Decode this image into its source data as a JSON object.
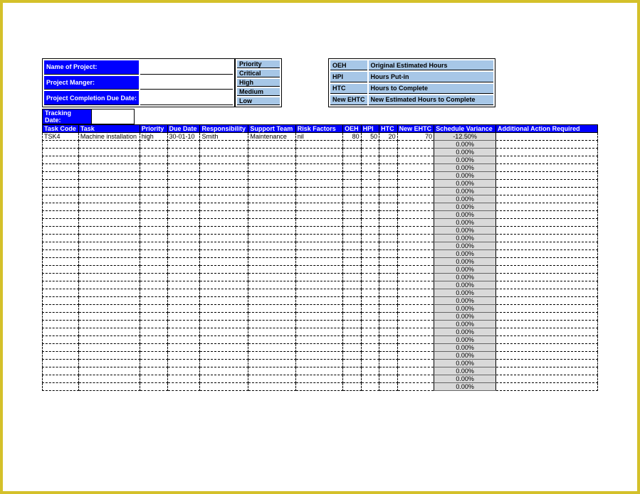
{
  "project": {
    "name_label": "Name of Project:",
    "manager_label": "Project Manger:",
    "due_label": "Project Completion Due Date:",
    "name": "",
    "manager": "",
    "due": ""
  },
  "priority": {
    "header": "Priority",
    "levels": [
      "Critical",
      "High",
      "Medium",
      "Low"
    ]
  },
  "legend": [
    {
      "abbr": "OEH",
      "full": "Original Estimated Hours"
    },
    {
      "abbr": "HPI",
      "full": "Hours Put-in"
    },
    {
      "abbr": "HTC",
      "full": "Hours to Complete"
    },
    {
      "abbr": "New EHTC",
      "full": "New Estimated Hours to Complete"
    }
  ],
  "tracking": {
    "label": "Tracking Date:",
    "value": ""
  },
  "columns": {
    "task_code": "Task Code",
    "task": "Task",
    "priority": "Priority",
    "due_date": "Due Date",
    "responsibility": "Responsibility",
    "support_team": "Support Team",
    "risk_factors": "Risk Factors",
    "oeh": "OEH",
    "hpi": "HPI",
    "htc": "HTC",
    "new_ehtc": "New EHTC",
    "schedule_variance": "Schedule Variance",
    "additional_action": "Additional Action Required"
  },
  "rows": [
    {
      "task_code": "TSK4",
      "task": "Machine installation",
      "priority": "high",
      "due_date": "30-01-10",
      "responsibility": "Smith",
      "support_team": "Maintenance",
      "risk_factors": "nil",
      "oeh": "80",
      "hpi": "50",
      "htc": "20",
      "new_ehtc": "70",
      "schedule_variance": "-12.50%",
      "additional_action": ""
    },
    {
      "schedule_variance": "0.00%"
    },
    {
      "schedule_variance": "0.00%"
    },
    {
      "schedule_variance": "0.00%"
    },
    {
      "schedule_variance": "0.00%"
    },
    {
      "schedule_variance": "0.00%"
    },
    {
      "schedule_variance": "0.00%"
    },
    {
      "schedule_variance": "0.00%"
    },
    {
      "schedule_variance": "0.00%"
    },
    {
      "schedule_variance": "0.00%"
    },
    {
      "schedule_variance": "0.00%"
    },
    {
      "schedule_variance": "0.00%"
    },
    {
      "schedule_variance": "0.00%"
    },
    {
      "schedule_variance": "0.00%"
    },
    {
      "schedule_variance": "0.00%"
    },
    {
      "schedule_variance": "0.00%"
    },
    {
      "schedule_variance": "0.00%"
    },
    {
      "schedule_variance": "0.00%"
    },
    {
      "schedule_variance": "0.00%"
    },
    {
      "schedule_variance": "0.00%"
    },
    {
      "schedule_variance": "0.00%"
    },
    {
      "schedule_variance": "0.00%"
    },
    {
      "schedule_variance": "0.00%"
    },
    {
      "schedule_variance": "0.00%"
    },
    {
      "schedule_variance": "0.00%"
    },
    {
      "schedule_variance": "0.00%"
    },
    {
      "schedule_variance": "0.00%"
    },
    {
      "schedule_variance": "0.00%"
    },
    {
      "schedule_variance": "0.00%"
    },
    {
      "schedule_variance": "0.00%"
    },
    {
      "schedule_variance": "0.00%"
    },
    {
      "schedule_variance": "0.00%"
    },
    {
      "schedule_variance": "0.00%"
    }
  ]
}
